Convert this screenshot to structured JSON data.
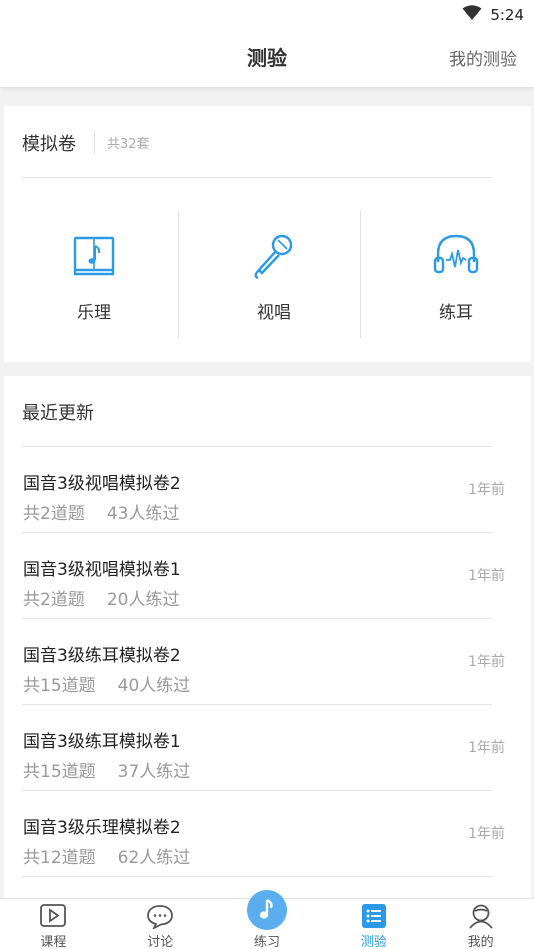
{
  "status_bar": {
    "time": "5:24"
  },
  "header": {
    "title": "测验",
    "my_tests": "我的测验"
  },
  "mock_section": {
    "title": "模拟卷",
    "count": "共32套",
    "categories": [
      {
        "label": "乐理",
        "icon": "music-book-icon"
      },
      {
        "label": "视唱",
        "icon": "microphone-icon"
      },
      {
        "label": "练耳",
        "icon": "headphones-icon"
      }
    ]
  },
  "recent": {
    "title": "最近更新",
    "items": [
      {
        "name": "国音3级视唱模拟卷2",
        "questions": "共2道题",
        "practiced": "43人练过",
        "time": "1年前"
      },
      {
        "name": "国音3级视唱模拟卷1",
        "questions": "共2道题",
        "practiced": "20人练过",
        "time": "1年前"
      },
      {
        "name": "国音3级练耳模拟卷2",
        "questions": "共15道题",
        "practiced": "40人练过",
        "time": "1年前"
      },
      {
        "name": "国音3级练耳模拟卷1",
        "questions": "共15道题",
        "practiced": "37人练过",
        "time": "1年前"
      },
      {
        "name": "国音3级乐理模拟卷2",
        "questions": "共12道题",
        "practiced": "62人练过",
        "time": "1年前"
      }
    ]
  },
  "tabbar": {
    "items": [
      {
        "label": "课程",
        "icon": "video-play-icon"
      },
      {
        "label": "讨论",
        "icon": "chat-bubble-icon"
      },
      {
        "label": "练习",
        "icon": "music-note-icon"
      },
      {
        "label": "测验",
        "icon": "list-icon",
        "active": true
      },
      {
        "label": "我的",
        "icon": "user-icon"
      }
    ]
  },
  "colors": {
    "accent": "#2b9ae6",
    "center_button": "#5aaef0"
  }
}
